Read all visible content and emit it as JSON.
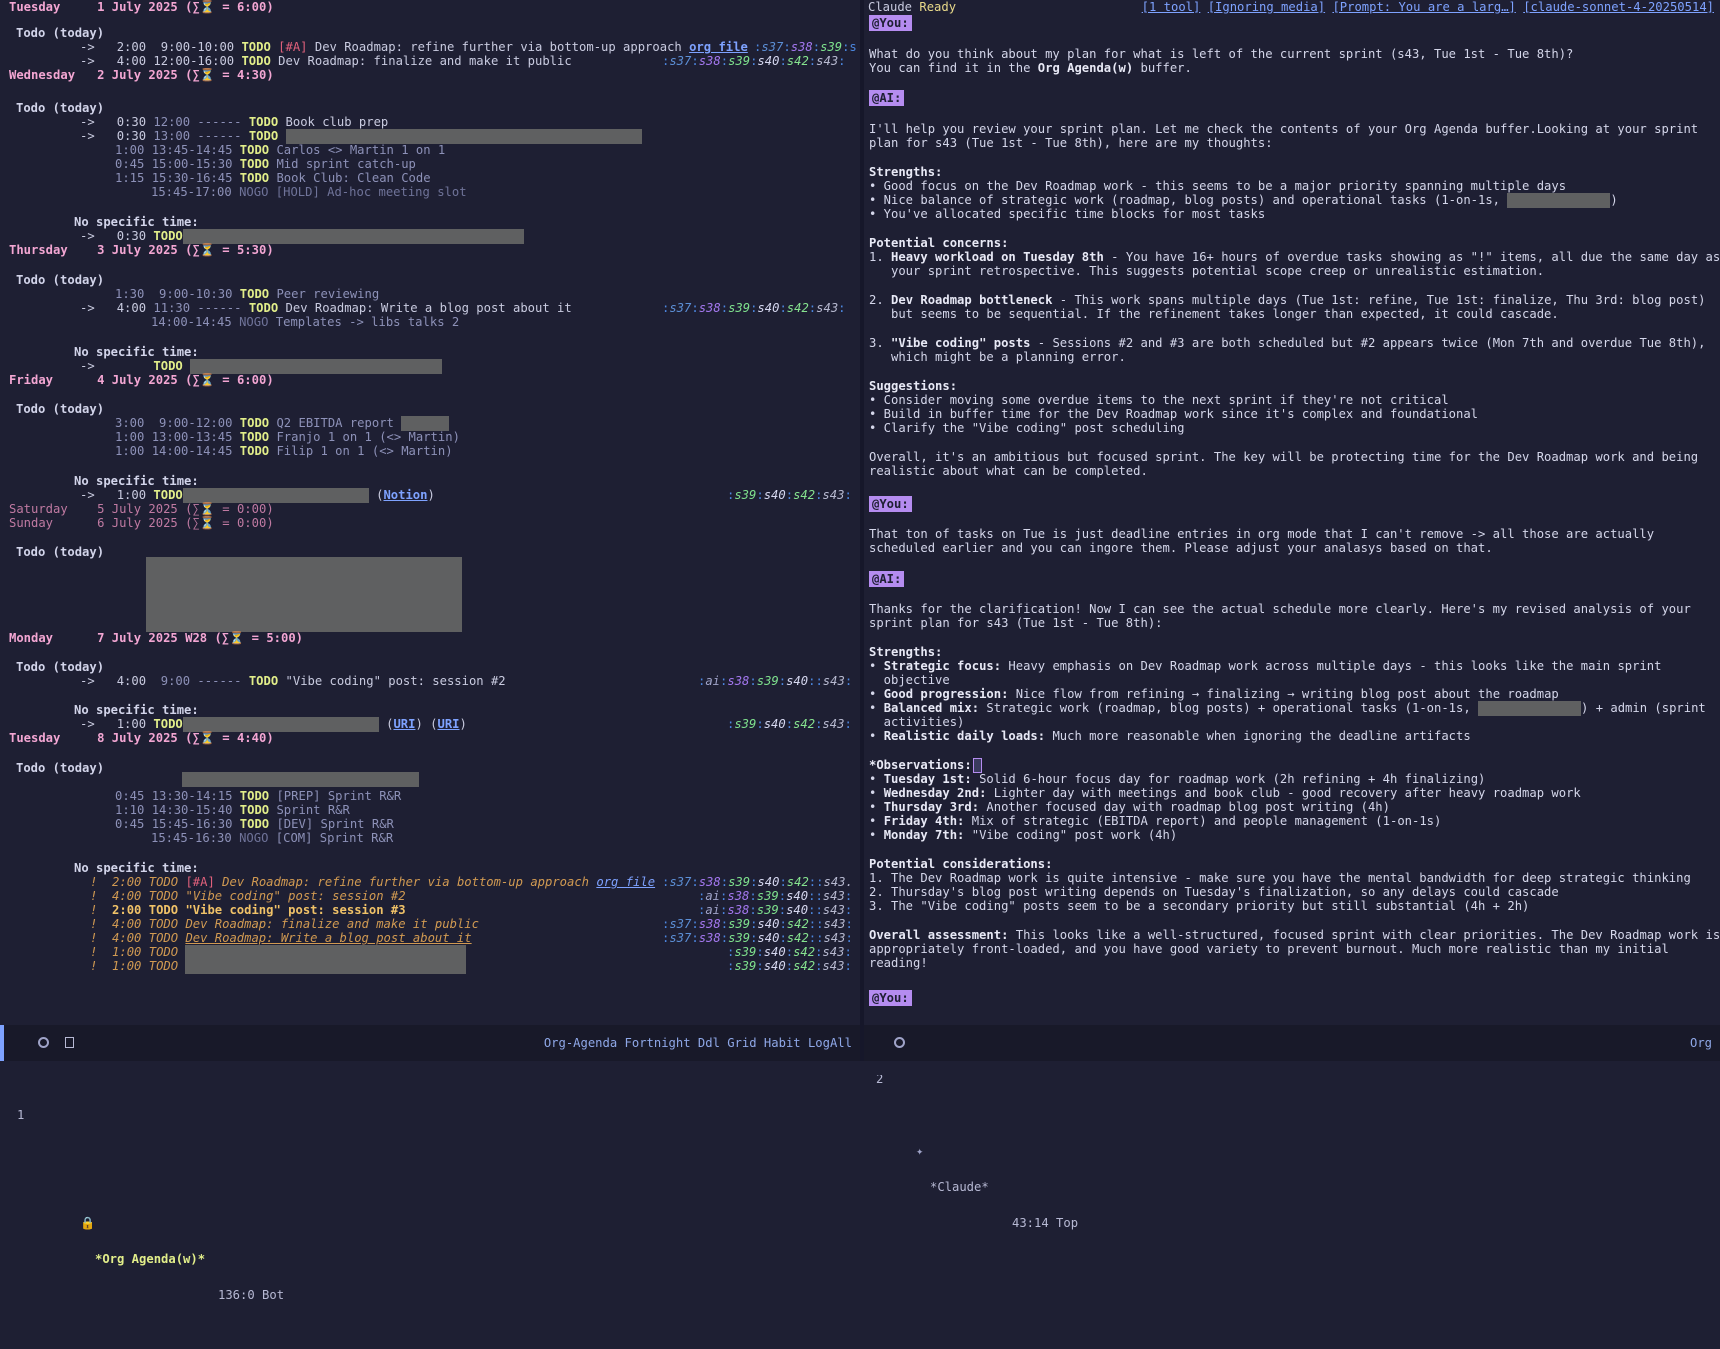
{
  "left_pane": {
    "days": {
      "tue1": {
        "weekday": "Tuesday",
        "date": "1 July 2025 (∑⏳ = 6:00)"
      },
      "wed2": {
        "weekday": "Wednesday",
        "date": "2 July 2025 (∑⏳ = 4:30)"
      },
      "thu3": {
        "weekday": "Thursday",
        "date": "3 July 2025 (∑⏳ = 5:30)"
      },
      "fri4": {
        "weekday": "Friday",
        "date": "4 July 2025 (∑⏳ = 6:00)"
      },
      "sat5": {
        "weekday": "Saturday",
        "date": "5 July 2025 (∑⏳ = 0:00)"
      },
      "sun6": {
        "weekday": "Sunday",
        "date": "6 July 2025 (∑⏳ = 0:00)"
      },
      "mon7": {
        "weekday": "Monday",
        "date": "7 July 2025 W28 (∑⏳ = 5:00)"
      },
      "tue8": {
        "weekday": "Tuesday",
        "date": "8 July 2025 (∑⏳ = 4:40)"
      }
    },
    "headers": {
      "todo_today": "Todo (today)",
      "no_specific": "No specific time:"
    },
    "entries": {
      "e1": {
        "prefix": "->",
        "dur": "2:00",
        "time": "9:00-10:00",
        "kw": "TODO",
        "pri": "[#A]",
        "text": "Dev Roadmap: refine further via bottom-up approach",
        "link": "org file",
        "tags": ":s37:s38:s39:s"
      },
      "e2": {
        "prefix": "->",
        "dur": "4:00",
        "time": "12:00-16:00",
        "kw": "TODO",
        "text": "Dev Roadmap: finalize and make it public",
        "tags": ":s37:s38:s39:s40:s42:s43:"
      },
      "e3": {
        "prefix": "->",
        "dur": "0:30",
        "time": "12:00 ------",
        "kw": "TODO",
        "text": "Book club prep"
      },
      "e4": {
        "prefix": "->",
        "dur": "0:30",
        "time": "13:00 ------",
        "kw": "TODO"
      },
      "e5": {
        "dur": "1:00",
        "time": "13:45-14:45",
        "kw": "TODO",
        "text": "Carlos <> Martin 1 on 1"
      },
      "e6": {
        "dur": "0:45",
        "time": "15:00-15:30",
        "kw": "TODO",
        "text": "Mid sprint catch-up"
      },
      "e7": {
        "dur": "1:15",
        "time": "15:30-16:45",
        "kw": "TODO",
        "text": "Book Club: Clean Code"
      },
      "e8": {
        "time": "15:45-17:00",
        "kw": "NOGO",
        "text": "[HOLD] Ad-hoc meeting slot"
      },
      "e9": {
        "prefix": "->",
        "dur": "0:30",
        "kw": "TODO"
      },
      "e10": {
        "dur": "1:30",
        "time": "9:00-10:30",
        "kw": "TODO",
        "text": "Peer reviewing"
      },
      "e11": {
        "prefix": "->",
        "dur": "4:00",
        "time": "11:30 ------",
        "kw": "TODO",
        "text": "Dev Roadmap: Write a blog post about it",
        "tags": ":s37:s38:s39:s40:s42:s43:"
      },
      "e12": {
        "time": "14:00-14:45",
        "kw": "NOGO",
        "text": "Templates -> libs talks 2"
      },
      "e13": {
        "prefix": "->",
        "kw": "TODO"
      },
      "e14": {
        "dur": "3:00",
        "time": "9:00-12:00",
        "kw": "TODO",
        "text": "Q2 EBITDA report"
      },
      "e15": {
        "dur": "1:00",
        "time": "13:00-13:45",
        "kw": "TODO",
        "text": "Franjo 1 on 1 (<> Martin)"
      },
      "e16": {
        "dur": "1:00",
        "time": "14:00-14:45",
        "kw": "TODO",
        "text": "Filip 1 on 1 (<> Martin)"
      },
      "e17": {
        "prefix": "->",
        "dur": "1:00",
        "kw": "TODO",
        "link": "Notion",
        "tags": ":s39:s40:s42:s43:"
      },
      "e18": {
        "prefix": "->",
        "dur": "4:00",
        "time": "9:00 ------",
        "kw": "TODO",
        "text": "\"Vibe coding\" post: session #2",
        "tags": ":ai:s38:s39:s40::s43:"
      },
      "e19": {
        "prefix": "->",
        "dur": "1:00",
        "kw": "TODO",
        "link1": "URI",
        "link2": "URI",
        "tags": ":s39:s40:s42:s43:"
      },
      "e20": {
        "dur": "0:45",
        "time": "13:30-14:15",
        "kw": "TODO",
        "text": "[PREP] Sprint R&R"
      },
      "e21": {
        "dur": "1:10",
        "time": "14:30-15:40",
        "kw": "TODO",
        "text": "Sprint R&R"
      },
      "e22": {
        "dur": "0:45",
        "time": "15:45-16:30",
        "kw": "TODO",
        "text": "[DEV] Sprint R&R"
      },
      "e23": {
        "time": "15:45-16:30",
        "kw": "NOGO",
        "text": "[COM] Sprint R&R"
      }
    },
    "overdue": {
      "o1": {
        "mark": "!",
        "dur": "2:00",
        "kw": "TODO",
        "pri": "[#A]",
        "text": "Dev Roadmap: refine further via bottom-up approach",
        "link": "org file",
        "tags": ":s37:s38:s39:s40:s42::s43."
      },
      "o2": {
        "mark": "!",
        "dur": "4:00",
        "kw": "TODO",
        "text": "\"Vibe coding\" post: session #2",
        "tags": ":ai:s38:s39:s40::s43:"
      },
      "o3": {
        "mark": "!",
        "dur": "2:00",
        "kw": "TODO",
        "text": "\"Vibe coding\" post: session #3",
        "tags": ":ai:s38:s39:s40::s43:"
      },
      "o4": {
        "mark": "!",
        "dur": "4:00",
        "kw": "TODO",
        "text": "Dev Roadmap: finalize and make it public",
        "tags": ":s37:s38:s39:s40:s42::s43:"
      },
      "o5": {
        "mark": "!",
        "dur": "4:00",
        "kw": "TODO",
        "text": "Dev Roadmap: Write a blog post about it",
        "tags": ":s37:s38:s39:s40:s42::s43:"
      },
      "o6": {
        "mark": "!",
        "dur": "1:00",
        "kw": "TODO",
        "tags": ":s39:s40:s42:s43:"
      },
      "o7": {
        "mark": "!",
        "dur": "1:00",
        "kw": "TODO",
        "tags": ":s39:s40:s42:s43:"
      }
    }
  },
  "right_pane": {
    "header": {
      "name": "Claude",
      "status": "Ready",
      "tool": "[1 tool]",
      "media": "[Ignoring media]",
      "prompt": "[Prompt: You are a larg…]",
      "model": "[claude-sonnet-4-20250514]"
    },
    "you_label": "@You:",
    "ai_label": "@AI:",
    "lines": {
      "u1a": "What do you think about my plan for what is left of the current sprint (s43, Tue 1st - Tue 8th)?",
      "u1b_pre": "You can find it in the ",
      "u1b_bold": "Org Agenda(w)",
      "u1b_post": " buffer.",
      "a1a": "I'll help you review your sprint plan. Let me check the contents of your Org Agenda buffer.Looking at your sprint",
      "a1b": "plan for s43 (Tue 1st - Tue 8th), here are my thoughts:",
      "s_strengths": "Strengths:",
      "a1c": "• Good focus on the Dev Roadmap work - this seems to be a major priority spanning multiple days",
      "a1d": "• Nice balance of strategic work (roadmap, blog posts) and operational tasks (1-on-1s, ",
      "a1d_end": ")",
      "a1e": "• You've allocated specific time blocks for most tasks",
      "s_concerns": "Potential concerns:",
      "c1_num": "1. ",
      "c1_bold": "Heavy workload on Tuesday 8th",
      "c1_rest": " - You have 16+ hours of overdue tasks showing as \"!\" items, all due the same day as",
      "c1b": "   your sprint retrospective. This suggests potential scope creep or unrealistic estimation.",
      "c2_num": "2. ",
      "c2_bold": "Dev Roadmap bottleneck",
      "c2_rest": " - This work spans multiple days (Tue 1st: refine, Tue 1st: finalize, Thu 3rd: blog post)",
      "c2b": "   but seems to be sequential. If the refinement takes longer than expected, it could cascade.",
      "c3_num": "3. ",
      "c3_bold": "\"Vibe coding\" posts",
      "c3_rest": " - Sessions #2 and #3 are both scheduled but #2 appears twice (Mon 7th and overdue Tue 8th),",
      "c3b": "   which might be a planning error.",
      "s_suggestions": "Suggestions:",
      "g1": "• Consider moving some overdue items to the next sprint if they're not critical",
      "g2": "• Build in buffer time for the Dev Roadmap work since it's complex and foundational",
      "g3": "• Clarify the \"Vibe coding\" post scheduling",
      "ov1": "Overall, it's an ambitious but focused sprint. The key will be protecting time for the Dev Roadmap work and being",
      "ov2": "realistic about what can be completed.",
      "u2a": "That ton of tasks on Tue is just deadline entries in org mode that I can't remove -> all those are actually",
      "u2b": "scheduled earlier and you can ingore them. Please adjust your analasys based on that.",
      "a2a": "Thanks for the clarification! Now I can see the actual schedule more clearly. Here's my revised analysis of your",
      "a2b": "sprint plan for s43 (Tue 1st - Tue 8th):",
      "s2_strengths": "Strengths:",
      "st1_b": "Strategic focus:",
      "st1": " Heavy emphasis on Dev Roadmap work across multiple days - this looks like the main sprint",
      "st1c": "  objective",
      "st2_b": "Good progression:",
      "st2": " Nice flow from refining → finalizing → writing blog post about the roadmap",
      "st3_b": "Balanced mix:",
      "st3": " Strategic work (roadmap, blog posts) + operational tasks (1-on-1s, ",
      "st3_end": ") + admin (sprint",
      "st3c": "  activities)",
      "st4_b": "Realistic daily loads:",
      "st4": " Much more reasonable when ignoring the deadline artifacts",
      "s_obs": "*Observations:",
      "ob1_b": "Tuesday 1st:",
      "ob1": " Solid 6-hour focus day for roadmap work (2h refining + 4h finalizing)",
      "ob2_b": "Wednesday 2nd:",
      "ob2": " Lighter day with meetings and book club - good recovery after heavy roadmap work",
      "ob3_b": "Thursday 3rd:",
      "ob3": " Another focused day with roadmap blog post writing (4h)",
      "ob4_b": "Friday 4th:",
      "ob4": " Mix of strategic (EBITDA report) and people management (1-on-1s)",
      "ob5_b": "Monday 7th:",
      "ob5": " \"Vibe coding\" post work (4h)",
      "s_consider": "Potential considerations:",
      "pc1": "1. The Dev Roadmap work is quite intensive - make sure you have the mental bandwidth for deep strategic thinking",
      "pc2": "2. Thursday's blog post writing depends on Tuesday's finalization, so any delays could cascade",
      "pc3": "3. The \"Vibe coding\" posts seem to be a secondary priority but still substantial (4h + 2h)",
      "oa_b": "Overall assessment:",
      "oa1": " This looks like a well-structured, focused sprint with clear priorities. The Dev Roadmap work is",
      "oa2": "appropriately front-loaded, and you have good variety to prevent burnout. Much more realistic than my initial",
      "oa3": "reading!"
    }
  },
  "modeline_left": {
    "window": "1",
    "buffer": "*Org Agenda(w)*",
    "pos": "136:0 Bot",
    "modes": "Org-Agenda Fortnight Ddl Grid Habit LogAll"
  },
  "modeline_right": {
    "window": "2",
    "buffer": "*Claude*",
    "pos": "43:14 Top",
    "mode": "Org"
  },
  "colors": {
    "background": "#1e1f33",
    "todo": "#e2ee8a",
    "date": "#f3a6d3",
    "label_bg": "#b58cf0",
    "link": "#7ea2ff"
  }
}
